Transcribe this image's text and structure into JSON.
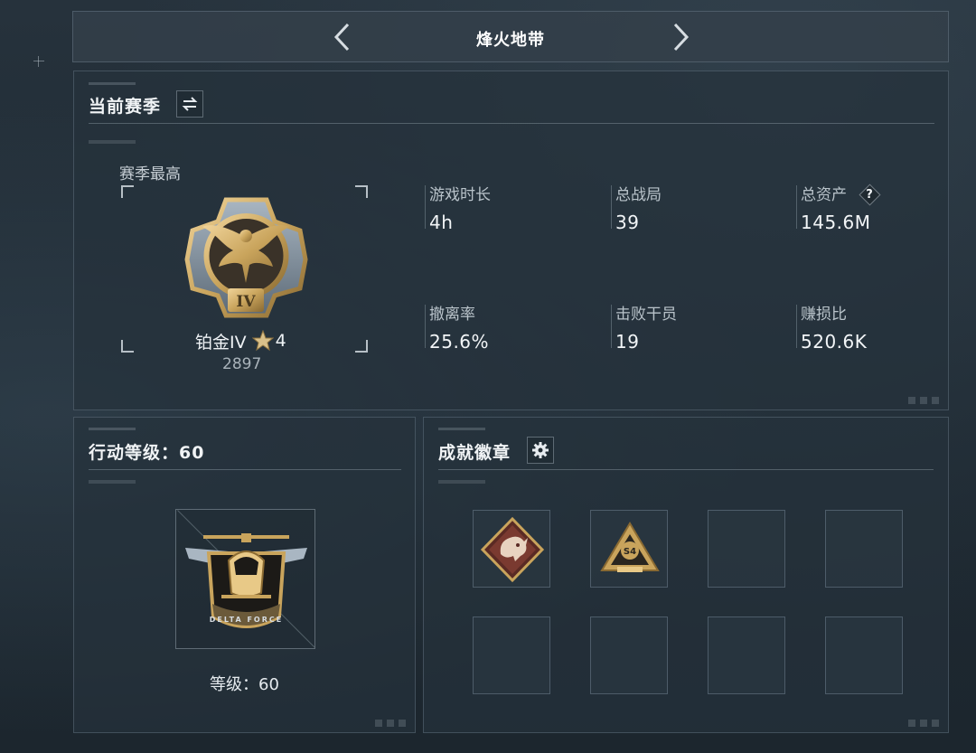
{
  "header": {
    "title": "烽火地带"
  },
  "season": {
    "title": "当前赛季",
    "best_label": "赛季最高",
    "rank_name": "铂金IV",
    "rank_stars": "4",
    "rank_score": "2897",
    "medal_numeral": "IV",
    "stats": [
      {
        "label": "游戏时长",
        "value": "4h"
      },
      {
        "label": "总战局",
        "value": "39"
      },
      {
        "label": "总资产",
        "value": "145.6M",
        "help": "?"
      },
      {
        "label": "撤离率",
        "value": "25.6%"
      },
      {
        "label": "击败干员",
        "value": "19"
      },
      {
        "label": "赚损比",
        "value": "520.6K"
      }
    ]
  },
  "level": {
    "title": "行动等级：60",
    "badge_text": "DELTA FORCE",
    "caption": "等级：60"
  },
  "achievements": {
    "title": "成就徽章",
    "badges": [
      {
        "name": "dragon-badge"
      },
      {
        "name": "s4-badge",
        "text": "S4"
      }
    ]
  },
  "colors": {
    "gold": "#c9a45c",
    "panel": "#26323c",
    "accent_text": "#f2f5f7"
  }
}
